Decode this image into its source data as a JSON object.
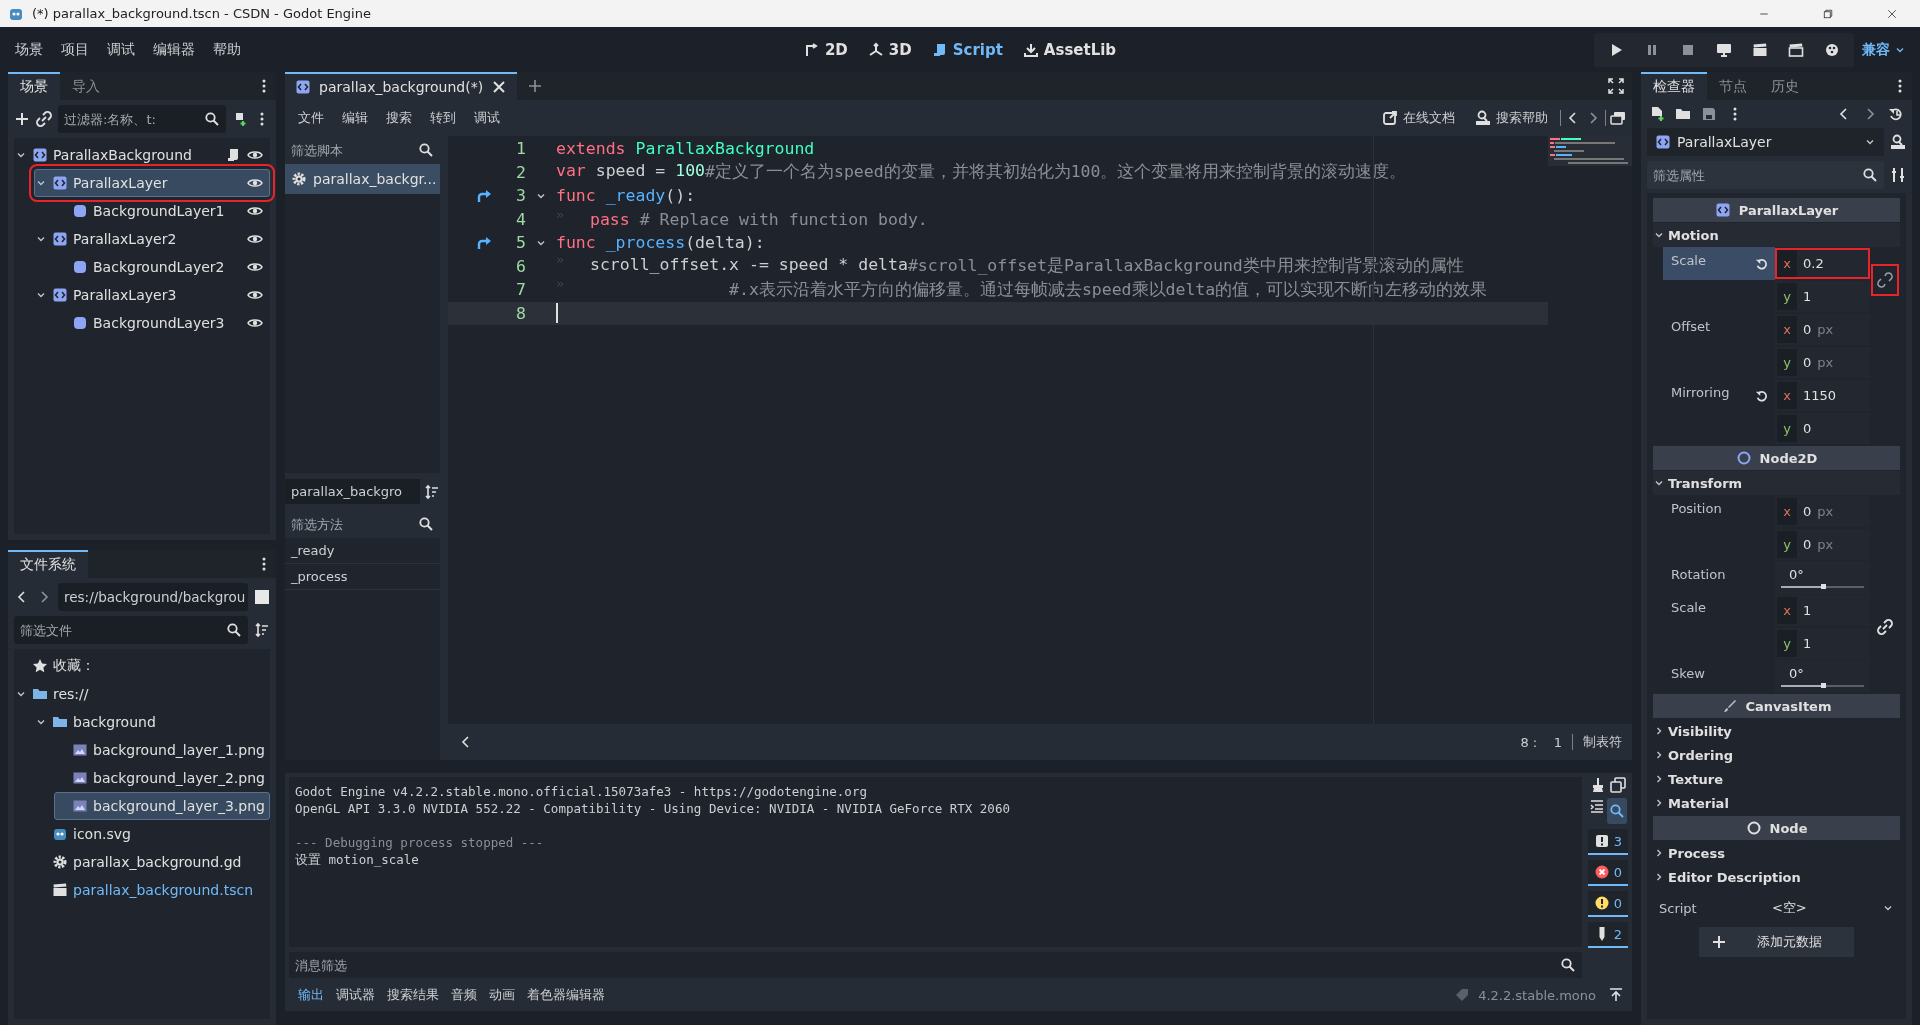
{
  "window": {
    "title": "(*) parallax_background.tscn - CSDN - Godot Engine"
  },
  "menu": [
    "场景",
    "项目",
    "调试",
    "编辑器",
    "帮助"
  ],
  "workspaces": [
    {
      "label": "2D",
      "kind": "planar",
      "selected": false
    },
    {
      "label": "3D",
      "kind": "spatial",
      "selected": false
    },
    {
      "label": "Script",
      "kind": "script",
      "selected": true
    },
    {
      "label": "AssetLib",
      "kind": "assetlib",
      "selected": false
    }
  ],
  "renderer": "兼容",
  "scene_dock": {
    "tabs": [
      {
        "label": "场景",
        "selected": true
      },
      {
        "label": "导入",
        "selected": false
      }
    ],
    "filter": {
      "placeholder": "过滤器:名称、t:"
    },
    "tree": [
      {
        "name": "ParallaxBackground",
        "kind": "parallax",
        "has_script": true,
        "selected": false,
        "highlighted": false,
        "children": [
          {
            "name": "ParallaxLayer",
            "kind": "parallax",
            "has_script": false,
            "selected": true,
            "highlighted": true,
            "children": [
              {
                "name": "BackgroundLayer1",
                "kind": "sprite",
                "has_script": false,
                "selected": false,
                "highlighted": false
              }
            ]
          },
          {
            "name": "ParallaxLayer2",
            "kind": "parallax",
            "has_script": false,
            "selected": false,
            "highlighted": false,
            "children": [
              {
                "name": "BackgroundLayer2",
                "kind": "sprite",
                "has_script": false,
                "selected": false,
                "highlighted": false
              }
            ]
          },
          {
            "name": "ParallaxLayer3",
            "kind": "parallax",
            "has_script": false,
            "selected": false,
            "highlighted": false,
            "children": [
              {
                "name": "BackgroundLayer3",
                "kind": "sprite",
                "has_script": false,
                "selected": false,
                "highlighted": false
              }
            ]
          }
        ]
      }
    ]
  },
  "filesystem": {
    "tab": "文件系统",
    "path": "res://background/backgrou",
    "filter": {
      "placeholder": "筛选文件"
    },
    "tree": [
      {
        "name": "收藏：",
        "kind": "favorites",
        "selected": false,
        "current": false
      },
      {
        "name": "res://",
        "kind": "folder",
        "selected": false,
        "current": false,
        "children": [
          {
            "name": "background",
            "kind": "folder",
            "selected": false,
            "current": false,
            "children": [
              {
                "name": "background_layer_1.png",
                "kind": "image",
                "selected": false,
                "current": false
              },
              {
                "name": "background_layer_2.png",
                "kind": "image",
                "selected": false,
                "current": false
              },
              {
                "name": "background_layer_3.png",
                "kind": "image",
                "selected": true,
                "current": false
              }
            ]
          },
          {
            "name": "icon.svg",
            "kind": "svg",
            "selected": false,
            "current": false
          },
          {
            "name": "parallax_background.gd",
            "kind": "script",
            "selected": false,
            "current": false
          },
          {
            "name": "parallax_background.tscn",
            "kind": "scene",
            "selected": false,
            "current": true
          }
        ]
      }
    ]
  },
  "script_editor": {
    "tab": "parallax_background(*)",
    "menu": [
      "文件",
      "编辑",
      "搜索",
      "转到",
      "调试"
    ],
    "links": [
      "在线文档",
      "搜索帮助"
    ],
    "script_filter": {
      "placeholder": "筛选脚本"
    },
    "scripts": [
      {
        "label": "parallax_backgr...",
        "selected": true
      }
    ],
    "current_script": "parallax_backgro",
    "method_filter": {
      "placeholder": "筛选方法"
    },
    "methods": [
      "_ready",
      "_process"
    ],
    "lines": [
      {
        "number": "1",
        "override": false,
        "foldable": false,
        "current": false,
        "tokens": [
          {
            "kind": "keyword",
            "text": "extends"
          },
          {
            "kind": "class",
            "text": " ParallaxBackground"
          }
        ]
      },
      {
        "number": "2",
        "override": false,
        "foldable": false,
        "current": false,
        "tokens": [
          {
            "kind": "keyword",
            "text": "var"
          },
          {
            "kind": "plain",
            "text": " speed = "
          },
          {
            "kind": "number",
            "text": "100"
          },
          {
            "kind": "comment",
            "text": "#定义了一个名为speed的变量，并将其初始化为100。这个变量将用来控制背景的滚动速度。"
          }
        ]
      },
      {
        "number": "3",
        "override": true,
        "foldable": true,
        "current": false,
        "tokens": [
          {
            "kind": "keyword",
            "text": "func"
          },
          {
            "kind": "function",
            "text": " _ready"
          },
          {
            "kind": "plain",
            "text": "():"
          }
        ]
      },
      {
        "number": "4",
        "override": false,
        "foldable": false,
        "current": false,
        "tokens": [
          {
            "kind": "tab"
          },
          {
            "kind": "keyword",
            "text": "pass"
          },
          {
            "kind": "comment",
            "text": " # Replace with function body."
          }
        ]
      },
      {
        "number": "5",
        "override": true,
        "foldable": true,
        "current": false,
        "tokens": [
          {
            "kind": "keyword",
            "text": "func"
          },
          {
            "kind": "function",
            "text": " _process"
          },
          {
            "kind": "plain",
            "text": "(delta):"
          }
        ]
      },
      {
        "number": "6",
        "override": false,
        "foldable": false,
        "current": false,
        "tokens": [
          {
            "kind": "tab"
          },
          {
            "kind": "plain",
            "text": "scroll_offset.x -= speed * delta"
          },
          {
            "kind": "comment",
            "text": "#scroll_offset是ParallaxBackground类中用来控制背景滚动的属性"
          }
        ]
      },
      {
        "number": "7",
        "override": false,
        "foldable": false,
        "current": false,
        "tokens": [
          {
            "kind": "tab"
          },
          {
            "kind": "comment",
            "text": "              #.x表示沿着水平方向的偏移量。通过每帧减去speed乘以delta的值，可以实现不断向左移动的效果"
          }
        ]
      },
      {
        "number": "8",
        "override": false,
        "foldable": false,
        "current": true
      }
    ],
    "cursor": "8 :    1",
    "indent_mode": "制表符"
  },
  "output": {
    "lines": [
      {
        "text": "Godot Engine v4.2.2.stable.mono.official.15073afe3 - https://godotengine.org",
        "kind": "normal",
        "gap_before": false
      },
      {
        "text": "OpenGL API 3.3.0 NVIDIA 552.22 - Compatibility - Using Device: NVIDIA - NVIDIA GeForce RTX 2060",
        "kind": "normal",
        "gap_before": false
      },
      {
        "text": "--- Debugging process stopped ---",
        "kind": "dim",
        "gap_before": true
      },
      {
        "text": "设置 motion_scale",
        "kind": "normal",
        "gap_before": false
      }
    ],
    "filter": {
      "placeholder": "消息筛选"
    },
    "counters": [
      {
        "kind": "message",
        "count": "3"
      },
      {
        "kind": "error",
        "count": "0"
      },
      {
        "kind": "warning",
        "count": "0"
      },
      {
        "kind": "editor",
        "count": "2"
      }
    ]
  },
  "bottom_tabs": [
    {
      "label": "输出",
      "selected": true
    },
    {
      "label": "调试器",
      "selected": false
    },
    {
      "label": "搜索结果",
      "selected": false
    },
    {
      "label": "音频",
      "selected": false
    },
    {
      "label": "动画",
      "selected": false
    },
    {
      "label": "着色器编辑器",
      "selected": false
    }
  ],
  "version": "4.2.2.stable.mono",
  "inspector": {
    "tabs": [
      {
        "label": "检查器",
        "selected": true
      },
      {
        "label": "节点",
        "selected": false
      },
      {
        "label": "历史",
        "selected": false
      }
    ],
    "node": "ParallaxLayer",
    "filter": {
      "placeholder": "筛选属性"
    },
    "items": [
      {
        "kind": "header",
        "label": "ParallaxLayer"
      },
      {
        "kind": "group",
        "label": "Motion",
        "expanded": true
      },
      {
        "kind": "vector",
        "label": "Scale",
        "selected": true,
        "revert": true,
        "linked": false,
        "highlighted": true,
        "components": [
          {
            "axis": "x",
            "value": "0.2",
            "highlighted": true
          },
          {
            "axis": "y",
            "value": "1",
            "highlighted": false
          }
        ]
      },
      {
        "kind": "vector",
        "label": "Offset",
        "selected": false,
        "revert": false,
        "components": [
          {
            "axis": "x",
            "value": "0",
            "unit": "px",
            "highlighted": false
          },
          {
            "axis": "y",
            "value": "0",
            "unit": "px",
            "highlighted": false
          }
        ]
      },
      {
        "kind": "vector",
        "label": "Mirroring",
        "selected": false,
        "revert": true,
        "components": [
          {
            "axis": "x",
            "value": "1150",
            "highlighted": false
          },
          {
            "axis": "y",
            "value": "0",
            "highlighted": false
          }
        ]
      },
      {
        "kind": "header",
        "label": "Node2D"
      },
      {
        "kind": "group",
        "label": "Transform",
        "expanded": true
      },
      {
        "kind": "vector",
        "label": "Position",
        "selected": false,
        "revert": false,
        "components": [
          {
            "axis": "x",
            "value": "0",
            "unit": "px",
            "highlighted": false
          },
          {
            "axis": "y",
            "value": "0",
            "unit": "px",
            "highlighted": false
          }
        ]
      },
      {
        "kind": "slider",
        "label": "Rotation",
        "value": "0",
        "unit": "°",
        "level": 0.5
      },
      {
        "kind": "vector",
        "label": "Scale",
        "selected": false,
        "revert": false,
        "linked": true,
        "highlighted": false,
        "components": [
          {
            "axis": "x",
            "value": "1",
            "highlighted": false
          },
          {
            "axis": "y",
            "value": "1",
            "highlighted": false
          }
        ]
      },
      {
        "kind": "slider",
        "label": "Skew",
        "value": "0",
        "unit": "°",
        "level": 0.5
      },
      {
        "kind": "header",
        "label": "CanvasItem"
      },
      {
        "kind": "group",
        "label": "Visibility",
        "expanded": false
      },
      {
        "kind": "group",
        "label": "Ordering",
        "expanded": false
      },
      {
        "kind": "group",
        "label": "Texture",
        "expanded": false
      },
      {
        "kind": "group",
        "label": "Material",
        "expanded": false
      },
      {
        "kind": "header",
        "label": "Node"
      },
      {
        "kind": "group",
        "label": "Process",
        "expanded": false
      },
      {
        "kind": "group",
        "label": "Editor Description",
        "expanded": false
      },
      {
        "kind": "script",
        "label": "Script",
        "value": "<空>"
      },
      {
        "kind": "add",
        "label": "添加元数据"
      }
    ]
  }
}
